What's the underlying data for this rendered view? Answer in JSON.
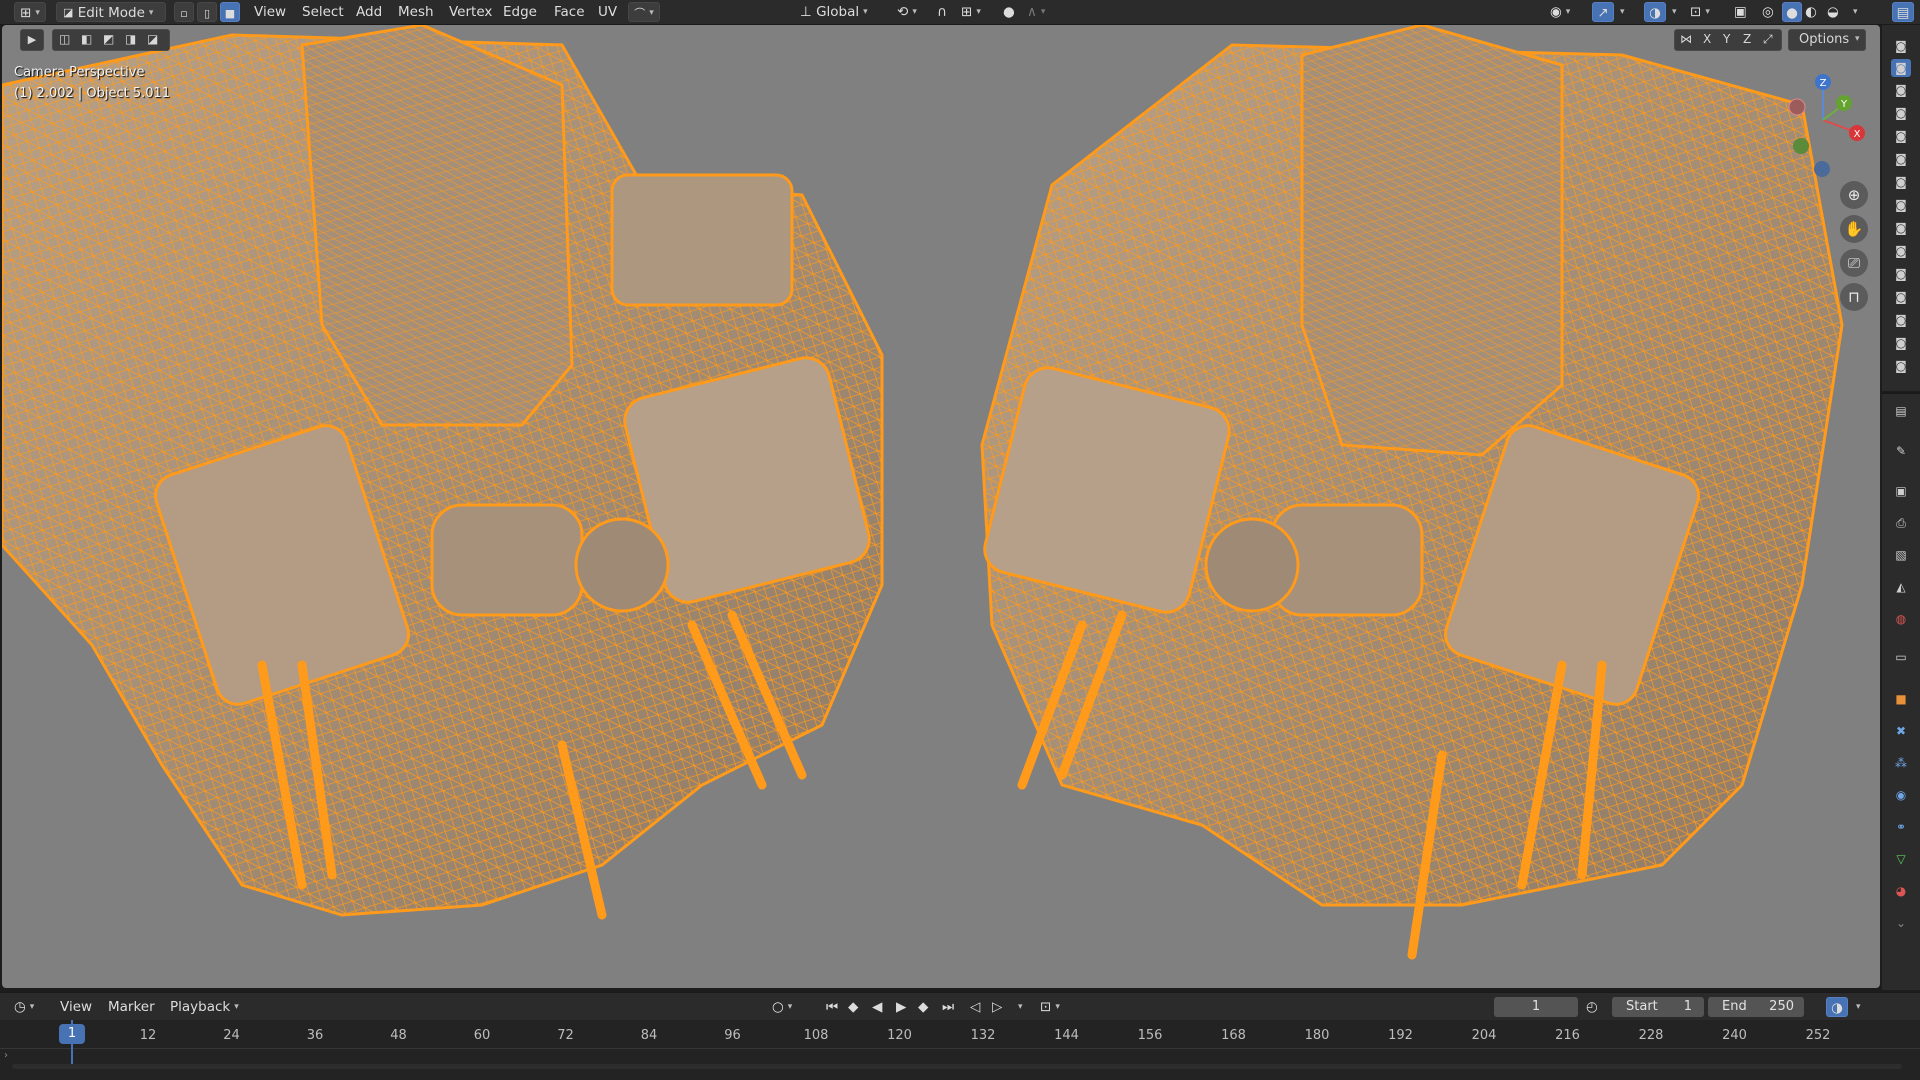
{
  "header": {
    "mode": "Edit Mode",
    "menus": [
      "View",
      "Select",
      "Add",
      "Mesh",
      "Vertex",
      "Edge",
      "Face",
      "UV"
    ],
    "transform_orientation": "Global",
    "options_label": "Options",
    "axis_labels": [
      "X",
      "Y",
      "Z"
    ]
  },
  "viewport": {
    "view_name": "Camera Perspective",
    "object_info": "(1) 2.002 | Object 5.011",
    "gizmo_axes": {
      "x": "X",
      "y": "Y",
      "z": "Z"
    },
    "wire_color": "#ff9a1a",
    "background_color": "#808080"
  },
  "timeline": {
    "menus": [
      "View",
      "Marker",
      "Playback"
    ],
    "current_frame": "1",
    "start_label": "Start",
    "start_value": "1",
    "end_label": "End",
    "end_value": "250",
    "playhead_label": "1",
    "ticks": [
      "12",
      "24",
      "36",
      "48",
      "60",
      "72",
      "84",
      "96",
      "108",
      "120",
      "132",
      "144",
      "156",
      "168",
      "180",
      "192",
      "204",
      "216",
      "228",
      "240",
      "252"
    ],
    "accent": "#4772b3"
  }
}
